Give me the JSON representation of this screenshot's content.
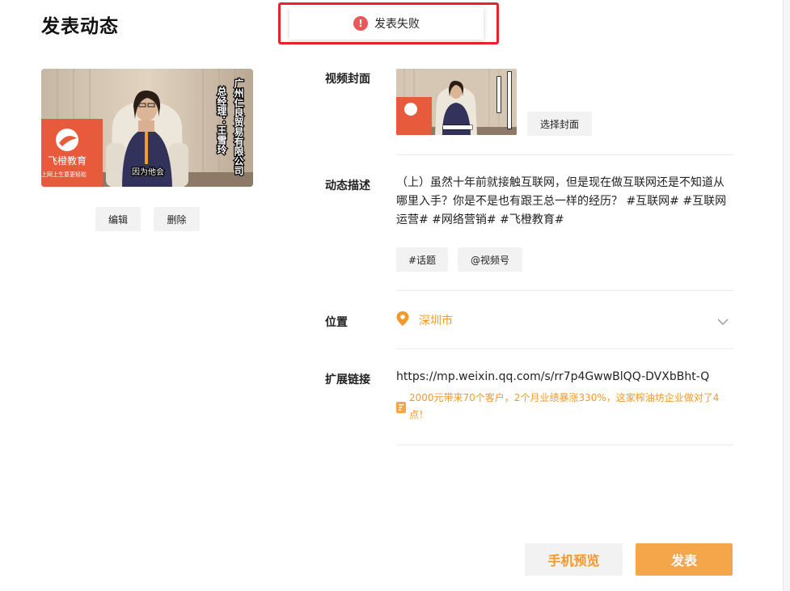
{
  "page": {
    "title": "发表动态"
  },
  "toast": {
    "message": "发表失败",
    "icon": "error-icon",
    "icon_glyph": "!"
  },
  "preview": {
    "overlay_company": "广州仁良贸易有限公司",
    "overlay_person": "总经理：王雪玲",
    "logo_text": "飞橙教育",
    "logo_subtext": "上网上生意更轻松",
    "subtitle": "因为他会",
    "edit_label": "编辑",
    "delete_label": "删除"
  },
  "form": {
    "cover": {
      "label": "视频封面",
      "select_label": "选择封面"
    },
    "description": {
      "label": "动态描述",
      "text": "（上）虽然十年前就接触互联网，但是现在做互联网还是不知道从哪里入手？你是不是也有跟王总一样的经历？ #互联网# #互联网运营# #网络营销# #飞橙教育#",
      "topic_label": "#话题",
      "mention_label": "@视频号"
    },
    "location": {
      "label": "位置",
      "value": "深圳市",
      "icon": "location-pin-icon"
    },
    "link": {
      "label": "扩展链接",
      "url": "https://mp.weixin.qq.com/s/rr7p4GwwBlQQ-DVXbBht-Q",
      "article_title": "2000元带来70个客户，2个月业绩暴涨330%，这家榨油坊企业做对了4点！",
      "article_icon": "article-icon"
    }
  },
  "actions": {
    "preview_label": "手机预览",
    "publish_label": "发表"
  },
  "colors": {
    "accent": "#f3982a",
    "error": "#e9575a",
    "highlight": "#e8242a"
  }
}
